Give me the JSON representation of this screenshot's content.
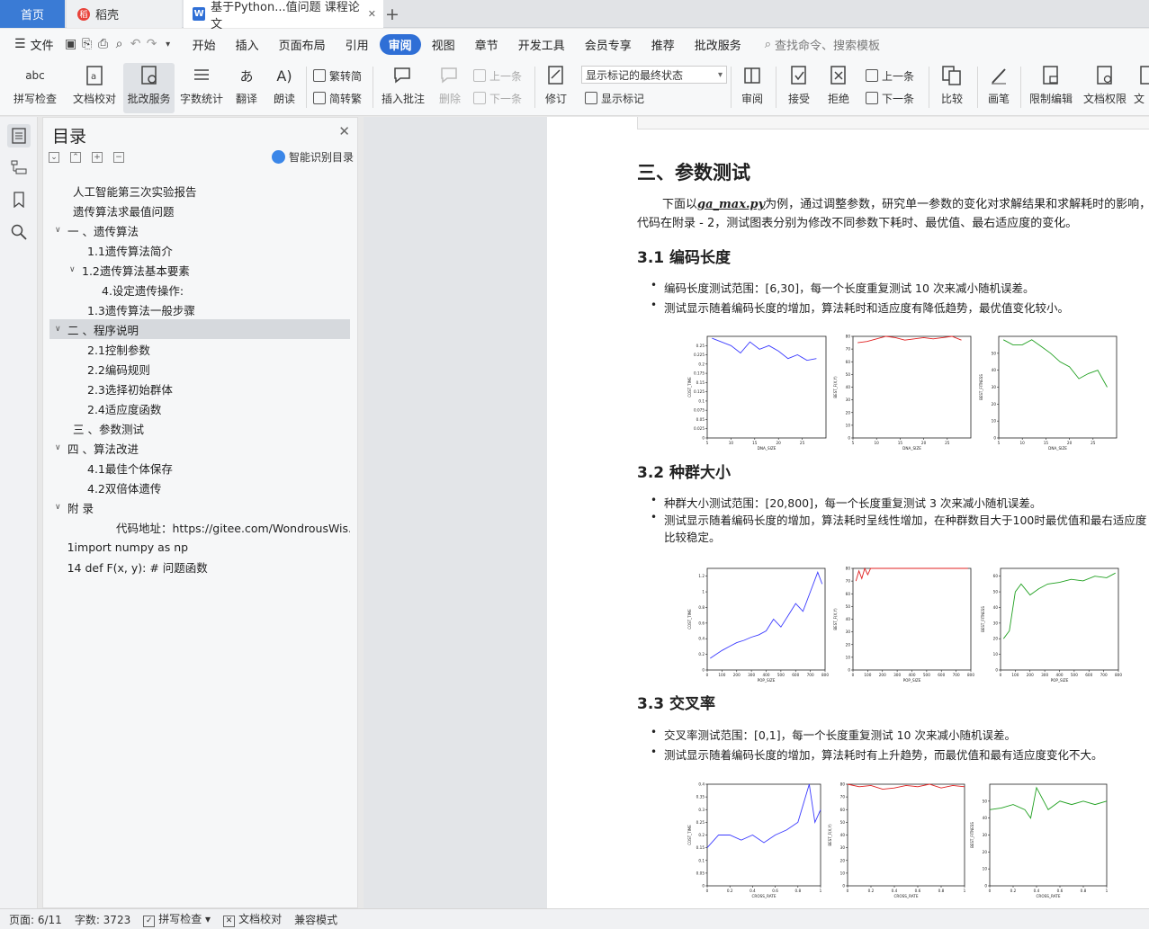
{
  "tabs": {
    "home": "首页",
    "daoke": "稻壳",
    "doc": "基于Python...值问题 课程论文"
  },
  "menu": {
    "file": "文件",
    "items": [
      "开始",
      "插入",
      "页面布局",
      "引用",
      "审阅",
      "视图",
      "章节",
      "开发工具",
      "会员专享",
      "推荐",
      "批改服务"
    ],
    "active": "审阅",
    "search": "查找命令、搜索模板"
  },
  "ribbon": {
    "spellcheck": "拼写检查",
    "doc_check": "文档校对",
    "grading": "批改服务",
    "wordcount": "字数统计",
    "translate": "翻译",
    "read": "朗读",
    "t2s": "繁转简",
    "s2t": "简转繁",
    "insert_comment": "插入批注",
    "delete": "删除",
    "prev_c": "上一条",
    "next_c": "下一条",
    "track": "修订",
    "markup_mode": "显示标记的最终状态",
    "show_markup": "显示标记",
    "review": "审阅",
    "accept": "接受",
    "reject": "拒绝",
    "prev": "上一条",
    "next": "下一条",
    "compare": "比较",
    "pen": "画笔",
    "restrict": "限制编辑",
    "perm": "文档权限",
    "more": "文"
  },
  "toc": {
    "title": "目录",
    "smart": "智能识别目录",
    "items": [
      {
        "t": "人工智能第三次实验报告",
        "indent": 1,
        "caret": ""
      },
      {
        "t": "遗传算法求最值问题",
        "indent": 1,
        "caret": ""
      },
      {
        "t": "一 、遗传算法",
        "indent": 0,
        "caret": "v"
      },
      {
        "t": "1.1遗传算法简介",
        "indent": 2,
        "caret": ""
      },
      {
        "t": "1.2遗传算法基本要素",
        "indent": 1,
        "caret": "v"
      },
      {
        "t": "4.设定遗传操作:",
        "indent": 3,
        "caret": ""
      },
      {
        "t": "1.3遗传算法一般步骤",
        "indent": 2,
        "caret": ""
      },
      {
        "t": "二 、程序说明",
        "indent": 0,
        "caret": "v",
        "sel": true
      },
      {
        "t": "2.1控制参数",
        "indent": 2,
        "caret": ""
      },
      {
        "t": "2.2编码规则",
        "indent": 2,
        "caret": ""
      },
      {
        "t": "2.3选择初始群体",
        "indent": 2,
        "caret": ""
      },
      {
        "t": "2.4适应度函数",
        "indent": 2,
        "caret": ""
      },
      {
        "t": "三 、参数测试",
        "indent": 1,
        "caret": ""
      },
      {
        "t": "四 、算法改进",
        "indent": 0,
        "caret": "v"
      },
      {
        "t": "4.1最佳个体保存",
        "indent": 2,
        "caret": ""
      },
      {
        "t": "4.2双倍体遗传",
        "indent": 2,
        "caret": ""
      },
      {
        "t": "附 录",
        "indent": 0,
        "caret": "v"
      },
      {
        "t": "代码地址：https://gitee.com/WondrousWis...",
        "indent": 4,
        "caret": ""
      },
      {
        "t": "1import numpy as np",
        "indent": 0.6,
        "caret": ""
      },
      {
        "t": "14 def F(x, y): # 问题函数",
        "indent": 0.6,
        "caret": ""
      }
    ]
  },
  "doc": {
    "h1": "三、参数测试",
    "intro1a": "下面以",
    "intro1b": "ga_max.py",
    "intro1c": "为例，通过调整参数，研究单一参数的变化对求解结果和求解耗时的影响，相关",
    "intro2": "代码在附录 - 2，测试图表分别为修改不同参数下耗时、最优值、最右适应度的变化。",
    "s1": {
      "title": "3.1 编码长度",
      "b1": "编码长度测试范围：[6,30]，每一个长度重复测试 10 次来减小随机误差。",
      "b2": "测试显示随着编码长度的增加，算法耗时和适应度有降低趋势，最优值变化较小。"
    },
    "s2": {
      "title": "3.2 种群大小",
      "b1": "种群大小测试范围：[20,800]，每一个长度重复测试 3 次来减小随机误差。",
      "b2": "测试显示随着编码长度的增加，算法耗时呈线性增加，在种群数目大于100时最优值和最右适应度",
      "b3": "比较稳定。"
    },
    "s3": {
      "title": "3.3 交叉率",
      "b1": "交叉率测试范围：[0,1]，每一个长度重复测试 10 次来减小随机误差。",
      "b2": "测试显示随着编码长度的增加，算法耗时有上升趋势，而最优值和最有适应度变化不大。"
    }
  },
  "chart_data": [
    {
      "type": "line",
      "xlabel": "DNA_SIZE",
      "ylabel": "COST_TIME",
      "color": "#3b3bff",
      "xlim": [
        5,
        30
      ],
      "ylim": [
        0,
        0.275
      ],
      "xticks": [
        5,
        10,
        15,
        20,
        25
      ],
      "yticks": [
        0,
        0.025,
        0.05,
        0.075,
        0.1,
        0.125,
        0.15,
        0.175,
        0.2,
        0.225,
        0.25
      ],
      "x": [
        6,
        8,
        10,
        12,
        14,
        16,
        18,
        20,
        22,
        24,
        26,
        28
      ],
      "values": [
        0.27,
        0.26,
        0.25,
        0.23,
        0.26,
        0.24,
        0.25,
        0.235,
        0.215,
        0.225,
        0.21,
        0.215
      ]
    },
    {
      "type": "line",
      "xlabel": "DNA_SIZE",
      "ylabel": "BEST_F(X,Y)",
      "color": "#e02020",
      "xlim": [
        5,
        30
      ],
      "ylim": [
        0,
        80
      ],
      "xticks": [
        5,
        10,
        15,
        20,
        25
      ],
      "yticks": [
        0,
        10,
        20,
        30,
        40,
        50,
        60,
        70,
        80
      ],
      "x": [
        6,
        8,
        10,
        12,
        14,
        16,
        18,
        20,
        22,
        24,
        26,
        28
      ],
      "values": [
        75,
        76,
        78,
        80,
        79,
        77,
        78,
        79,
        78,
        79,
        80,
        77
      ]
    },
    {
      "type": "line",
      "xlabel": "DNA_SIZE",
      "ylabel": "BEST_FITNESS",
      "color": "#20a020",
      "xlim": [
        5,
        30
      ],
      "ylim": [
        0,
        60
      ],
      "xticks": [
        5,
        10,
        15,
        20,
        25
      ],
      "yticks": [
        0,
        10,
        20,
        30,
        40,
        50
      ],
      "x": [
        6,
        8,
        10,
        12,
        14,
        16,
        18,
        20,
        22,
        24,
        26,
        28
      ],
      "values": [
        58,
        55,
        55,
        58,
        54,
        50,
        45,
        42,
        35,
        38,
        40,
        30
      ]
    },
    {
      "type": "line",
      "xlabel": "POP_SIZE",
      "ylabel": "COST_TIME",
      "color": "#3b3bff",
      "xlim": [
        0,
        800
      ],
      "ylim": [
        0,
        1.3
      ],
      "xticks": [
        0,
        100,
        200,
        300,
        400,
        500,
        600,
        700,
        800
      ],
      "yticks": [
        0,
        0.2,
        0.4,
        0.6,
        0.8,
        1.0,
        1.2
      ],
      "x": [
        20,
        60,
        100,
        150,
        200,
        250,
        300,
        350,
        400,
        450,
        500,
        550,
        600,
        650,
        700,
        750,
        780
      ],
      "values": [
        0.15,
        0.2,
        0.25,
        0.3,
        0.35,
        0.38,
        0.42,
        0.45,
        0.5,
        0.65,
        0.55,
        0.7,
        0.85,
        0.75,
        1.0,
        1.25,
        1.1
      ]
    },
    {
      "type": "line",
      "xlabel": "POP_SIZE",
      "ylabel": "BEST_F(X,Y)",
      "color": "#e02020",
      "xlim": [
        0,
        800
      ],
      "ylim": [
        0,
        80
      ],
      "xticks": [
        0,
        100,
        200,
        300,
        400,
        500,
        600,
        700,
        800
      ],
      "yticks": [
        0,
        10,
        20,
        30,
        40,
        50,
        60,
        70,
        80
      ],
      "x": [
        20,
        40,
        60,
        80,
        100,
        120,
        150,
        200,
        300,
        400,
        500,
        600,
        700,
        780
      ],
      "values": [
        70,
        78,
        72,
        80,
        75,
        80,
        80,
        80,
        80,
        80,
        80,
        80,
        80,
        80
      ]
    },
    {
      "type": "line",
      "xlabel": "POP_SIZE",
      "ylabel": "BEST_FITNESS",
      "color": "#20a020",
      "xlim": [
        0,
        800
      ],
      "ylim": [
        0,
        65
      ],
      "xticks": [
        0,
        100,
        200,
        300,
        400,
        500,
        600,
        700,
        800
      ],
      "yticks": [
        0,
        10,
        20,
        30,
        40,
        50,
        60
      ],
      "x": [
        20,
        60,
        100,
        140,
        200,
        260,
        320,
        400,
        480,
        560,
        640,
        720,
        780
      ],
      "values": [
        20,
        25,
        50,
        55,
        48,
        52,
        55,
        56,
        58,
        57,
        60,
        59,
        62
      ]
    },
    {
      "type": "line",
      "xlabel": "CROSS_RATE",
      "ylabel": "COST_TIME",
      "color": "#3b3bff",
      "xlim": [
        0,
        1
      ],
      "ylim": [
        0,
        0.4
      ],
      "xticks": [
        0,
        0.2,
        0.4,
        0.6,
        0.8,
        1.0
      ],
      "yticks": [
        0,
        0.05,
        0.1,
        0.15,
        0.2,
        0.25,
        0.3,
        0.35,
        0.4
      ],
      "x": [
        0,
        0.1,
        0.2,
        0.3,
        0.4,
        0.5,
        0.6,
        0.7,
        0.8,
        0.9,
        0.95,
        1.0
      ],
      "values": [
        0.15,
        0.2,
        0.2,
        0.18,
        0.2,
        0.17,
        0.2,
        0.22,
        0.25,
        0.4,
        0.25,
        0.3
      ]
    },
    {
      "type": "line",
      "xlabel": "CROSS_RATE",
      "ylabel": "BEST_F(X,Y)",
      "color": "#e02020",
      "xlim": [
        0,
        1
      ],
      "ylim": [
        0,
        80
      ],
      "xticks": [
        0,
        0.2,
        0.4,
        0.6,
        0.8,
        1.0
      ],
      "yticks": [
        0,
        10,
        20,
        30,
        40,
        50,
        60,
        70,
        80
      ],
      "x": [
        0,
        0.1,
        0.2,
        0.3,
        0.4,
        0.5,
        0.6,
        0.7,
        0.8,
        0.9,
        1.0
      ],
      "values": [
        80,
        78,
        79,
        76,
        77,
        79,
        78,
        80,
        77,
        79,
        78
      ]
    },
    {
      "type": "line",
      "xlabel": "CROSS_RATE",
      "ylabel": "BEST_FITNESS",
      "color": "#20a020",
      "xlim": [
        0,
        1
      ],
      "ylim": [
        0,
        60
      ],
      "xticks": [
        0,
        0.2,
        0.4,
        0.6,
        0.8,
        1.0
      ],
      "yticks": [
        0,
        10,
        20,
        30,
        40,
        50
      ],
      "x": [
        0,
        0.1,
        0.2,
        0.3,
        0.35,
        0.4,
        0.5,
        0.6,
        0.7,
        0.8,
        0.9,
        1.0
      ],
      "values": [
        45,
        46,
        48,
        45,
        40,
        58,
        45,
        50,
        48,
        50,
        48,
        50
      ]
    }
  ],
  "status": {
    "page": "页面: 6/11",
    "words": "字数: 3723",
    "spell": "拼写检查",
    "check": "文档校对",
    "compat": "兼容模式"
  }
}
